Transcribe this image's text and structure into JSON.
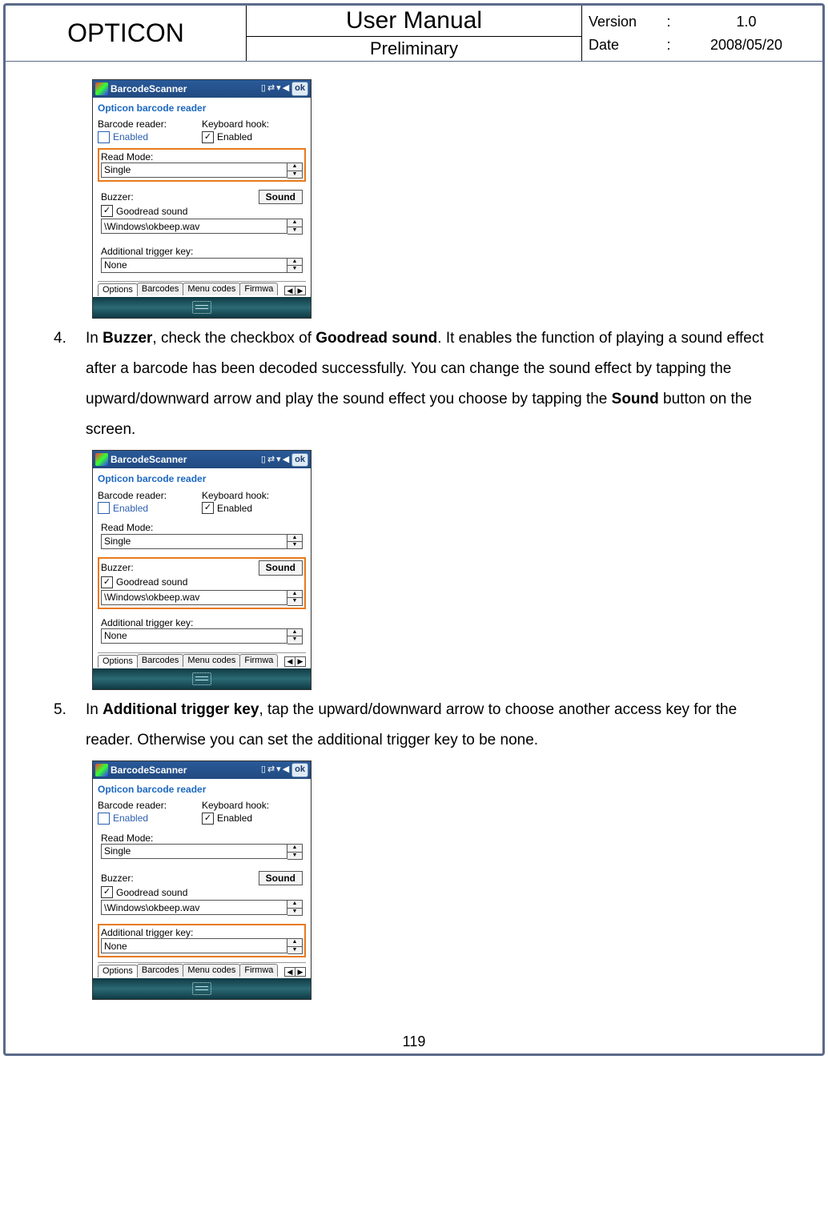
{
  "header": {
    "brand": "OPTICON",
    "title": "User Manual",
    "subtitle": "Preliminary",
    "version_label": "Version",
    "version_value": "1.0",
    "date_label": "Date",
    "date_value": "2008/05/20"
  },
  "steps": {
    "s4": {
      "num": "4.",
      "pre": "In ",
      "b1": "Buzzer",
      "mid1": ", check the checkbox of ",
      "b2": "Goodread sound",
      "mid2": ". It enables the function of playing a sound effect after a barcode has been decoded successfully. You can change the sound effect by tapping the upward/downward arrow and play the sound effect you choose by tapping the ",
      "b3": "Sound",
      "post": " button on the screen."
    },
    "s5": {
      "num": "5.",
      "pre": "In ",
      "b1": "Additional trigger key",
      "post": ", tap the upward/downward arrow to choose another access key for the reader. Otherwise you can set the additional trigger key to be none."
    }
  },
  "shot": {
    "title": "BarcodeScanner",
    "ok": "ok",
    "subtitle": "Opticon barcode reader",
    "barcode_reader_label": "Barcode reader:",
    "keyboard_hook_label": "Keyboard hook:",
    "enabled": "Enabled",
    "read_mode_label": "Read Mode:",
    "read_mode_value": "Single",
    "buzzer_label": "Buzzer:",
    "goodread": "Goodread sound",
    "sound_btn": "Sound",
    "sound_path": "\\Windows\\okbeep.wav",
    "trigger_label": "Additional trigger key:",
    "trigger_value": "None",
    "tabs": {
      "t1": "Options",
      "t2": "Barcodes",
      "t3": "Menu codes",
      "t4": "Firmwa"
    }
  },
  "pagenum": "119"
}
